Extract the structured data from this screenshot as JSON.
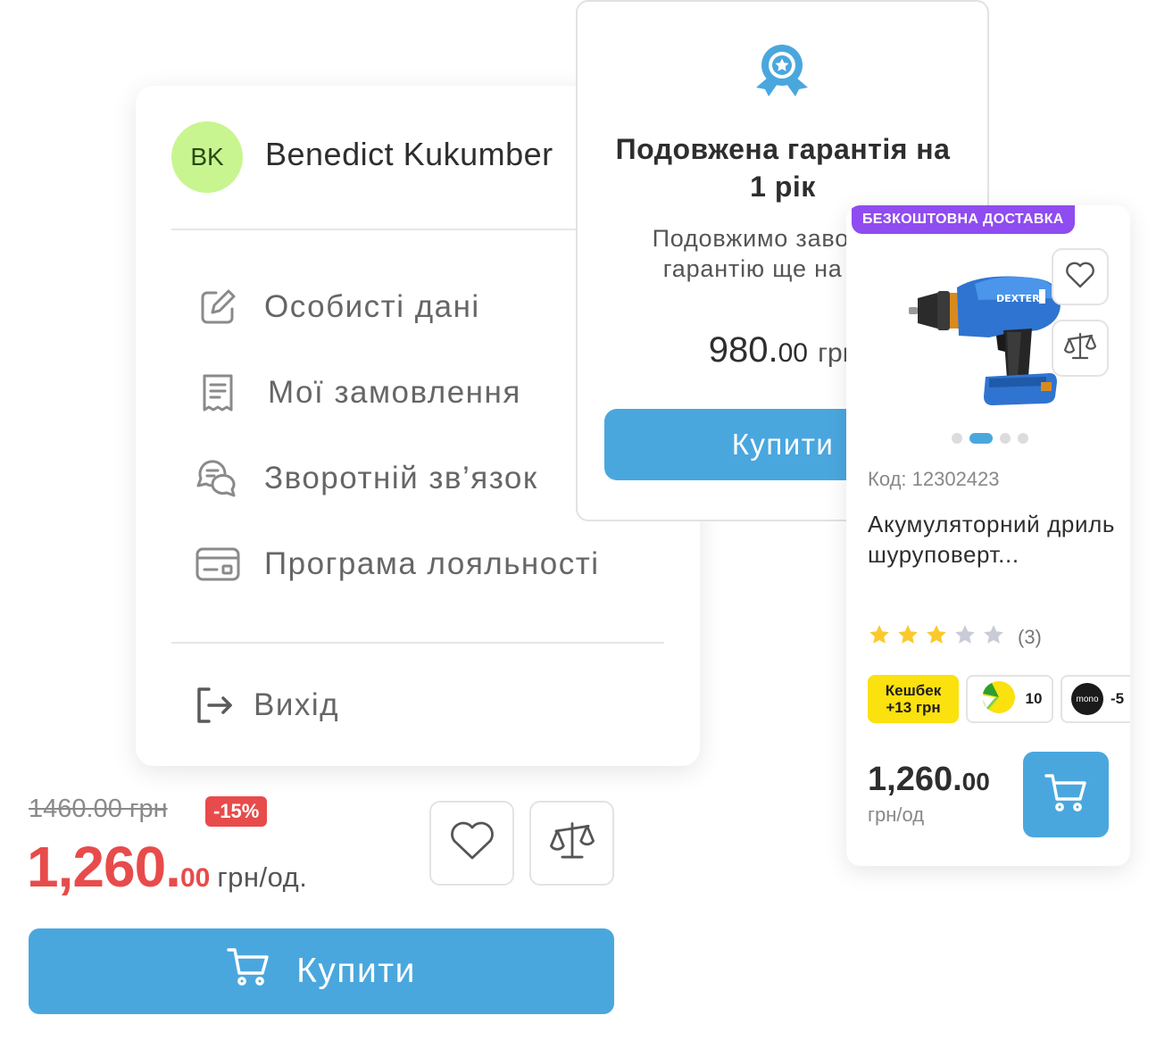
{
  "account": {
    "avatar_initials": "BK",
    "user_name": "Benedict Kukumber",
    "menu": [
      {
        "label": "Особисті дані",
        "icon": "edit-icon"
      },
      {
        "label": "Мої замовлення",
        "icon": "receipt-icon"
      },
      {
        "label": "Зворотній зв’язок",
        "icon": "chat-icon"
      },
      {
        "label": "Програма лояльності",
        "icon": "card-icon"
      }
    ],
    "logout_label": "Вихід",
    "avatar_color": "#c8f590"
  },
  "warranty": {
    "title": "Подовжена гарантія на 1 рік",
    "description": "Подовжимо заводську гарантію ще на 1 рік",
    "price_int": "980.",
    "price_cents": "00",
    "currency": "грн",
    "buy_label": "Купити"
  },
  "product": {
    "badge": "БЕЗКОШТОВНА ДОСТАВКА",
    "code": "Код: 12302423",
    "title": "Акумуляторний дриль шуруповерт...",
    "rating": 3,
    "rating_max": 5,
    "rating_count": "(3)",
    "cashback_line1": "Кешбек",
    "cashback_line2": "+13 грн",
    "installments": "10",
    "mono_logo": "mono",
    "mono_value": "-5",
    "price_int": "1,260.",
    "price_cents": "00",
    "unit": "грн/од",
    "image_dots": 4,
    "active_dot": 1,
    "badge_color": "#8f4cf0"
  },
  "offer": {
    "old_price": "1460.00 грн",
    "discount": "-15%",
    "price_int": "1,260.",
    "price_cents": "00",
    "unit": "грн/од.",
    "buy_label": "Купити"
  },
  "colors": {
    "accent": "#4aa7de",
    "sale": "#e84b4b",
    "star": "#fbc92c"
  }
}
